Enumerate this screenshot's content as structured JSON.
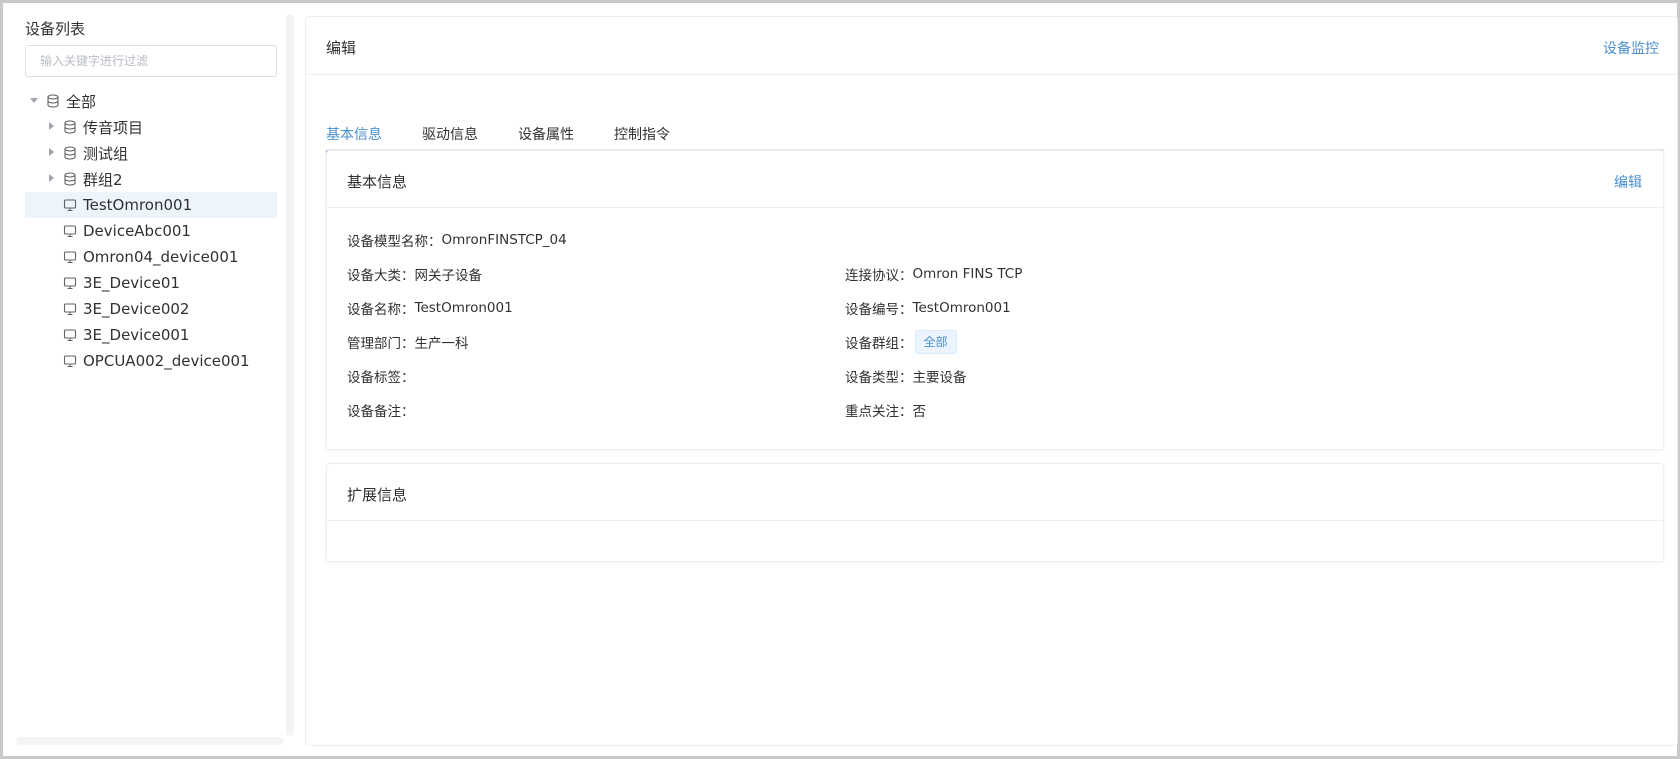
{
  "sidebar": {
    "title": "设备列表",
    "filter_placeholder": "输入关键字进行过滤",
    "tree": {
      "root": "全部",
      "groups": [
        "传音项目",
        "测试组",
        "群组2"
      ],
      "devices": [
        "TestOmron001",
        "DeviceAbc001",
        "Omron04_device001",
        "3E_Device01",
        "3E_Device002",
        "3E_Device001",
        "OPCUA002_device001"
      ]
    }
  },
  "main": {
    "title": "编辑",
    "monitor_link": "设备监控",
    "tabs": [
      "基本信息",
      "驱动信息",
      "设备属性",
      "控制指令"
    ],
    "basic_card": {
      "title": "基本信息",
      "edit_label": "编辑",
      "fields": {
        "model_name": {
          "label": "设备模型名称：",
          "value": "OmronFINSTCP_04"
        },
        "category": {
          "label": "设备大类：",
          "value": "网关子设备"
        },
        "protocol": {
          "label": "连接协议：",
          "value": "Omron FINS TCP"
        },
        "device_name": {
          "label": "设备名称：",
          "value": "TestOmron001"
        },
        "device_code": {
          "label": "设备编号：",
          "value": "TestOmron001"
        },
        "department": {
          "label": "管理部门：",
          "value": "生产一科"
        },
        "group": {
          "label": "设备群组：",
          "value": "全部"
        },
        "tags": {
          "label": "设备标签：",
          "value": ""
        },
        "device_type": {
          "label": "设备类型：",
          "value": "主要设备"
        },
        "remarks": {
          "label": "设备备注：",
          "value": ""
        },
        "key_focus": {
          "label": "重点关注：",
          "value": "否"
        }
      }
    },
    "ext_card": {
      "title": "扩展信息"
    }
  },
  "colors": {
    "accent": "#4a8fd0",
    "border": "#ebeef5",
    "active_row": "#eef4fb",
    "tag_bg": "#ecf5ff"
  }
}
